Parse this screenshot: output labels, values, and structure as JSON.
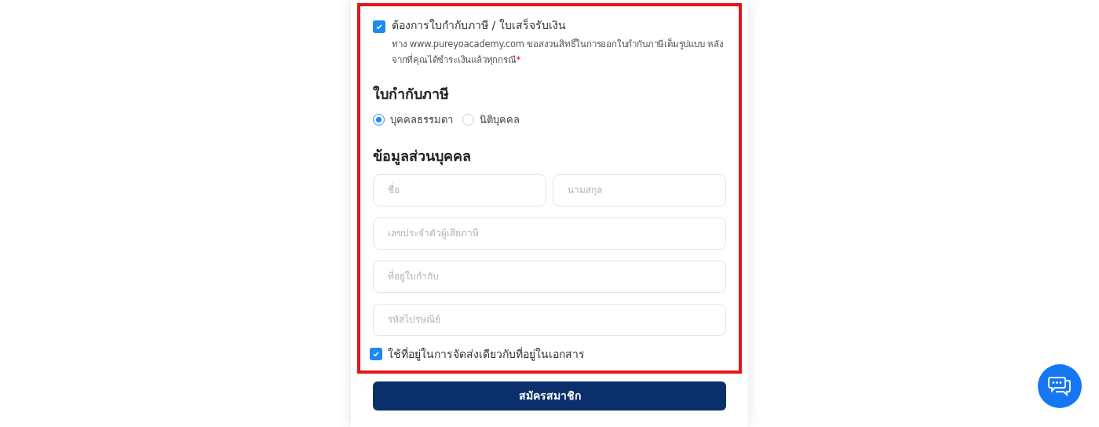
{
  "tax_request": {
    "checked": true,
    "label": "ต้องการใบกำกับภาษี / ใบเสร็จรับเงิน",
    "note": "ทาง www.pureyoacademy.com ขอสงวนสิทธิ์ในการออกใบกำกับภาษีเต็มรูปแบบ หลังจากที่คุณได้ชำระเงินแล้วทุกกรณี",
    "required_mark": "*"
  },
  "invoice_section": {
    "title": "ใบกำกับภาษี",
    "options": [
      {
        "label": "บุคคลธรรมดา",
        "selected": true
      },
      {
        "label": "นิติบุคคล",
        "selected": false
      }
    ]
  },
  "personal_section": {
    "title": "ข้อมูลส่วนบุคคล",
    "name_row": [
      {
        "placeholder": "ชื่อ"
      },
      {
        "placeholder": "นามสกุล"
      }
    ],
    "fields": [
      {
        "placeholder": "เลขประจำตัวผู้เสียภาษี"
      },
      {
        "placeholder": "ที่อยู่ใบกำกับ"
      },
      {
        "placeholder": "รหัสไปรษณีย์"
      }
    ]
  },
  "same_address": {
    "checked": true,
    "label": "ใช้ที่อยู่ในการจัดส่งเดียวกับที่อยู่ในเอกสาร"
  },
  "submit_button": "สมัครสมาชิก"
}
